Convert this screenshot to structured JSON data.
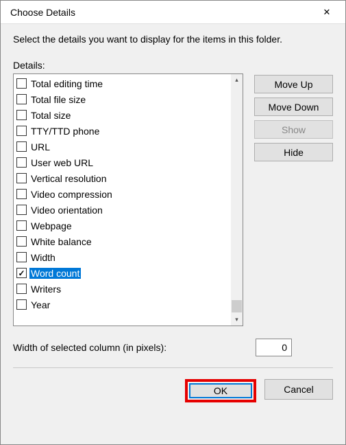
{
  "window": {
    "title": "Choose Details",
    "close_glyph": "✕"
  },
  "instruction": "Select the details you want to display for the items in this folder.",
  "details_label": "Details:",
  "items": [
    {
      "label": "Total editing time",
      "checked": false,
      "selected": false
    },
    {
      "label": "Total file size",
      "checked": false,
      "selected": false
    },
    {
      "label": "Total size",
      "checked": false,
      "selected": false
    },
    {
      "label": "TTY/TTD phone",
      "checked": false,
      "selected": false
    },
    {
      "label": "URL",
      "checked": false,
      "selected": false
    },
    {
      "label": "User web URL",
      "checked": false,
      "selected": false
    },
    {
      "label": "Vertical resolution",
      "checked": false,
      "selected": false
    },
    {
      "label": "Video compression",
      "checked": false,
      "selected": false
    },
    {
      "label": "Video orientation",
      "checked": false,
      "selected": false
    },
    {
      "label": "Webpage",
      "checked": false,
      "selected": false
    },
    {
      "label": "White balance",
      "checked": false,
      "selected": false
    },
    {
      "label": "Width",
      "checked": false,
      "selected": false
    },
    {
      "label": "Word count",
      "checked": true,
      "selected": true
    },
    {
      "label": "Writers",
      "checked": false,
      "selected": false
    },
    {
      "label": "Year",
      "checked": false,
      "selected": false
    }
  ],
  "side_buttons": {
    "move_up": "Move Up",
    "move_down": "Move Down",
    "show": "Show",
    "hide": "Hide",
    "show_disabled": true
  },
  "width_field": {
    "label": "Width of selected column (in pixels):",
    "value": "0"
  },
  "bottom": {
    "ok": "OK",
    "cancel": "Cancel"
  },
  "scroll": {
    "up_glyph": "▴",
    "down_glyph": "▾"
  }
}
